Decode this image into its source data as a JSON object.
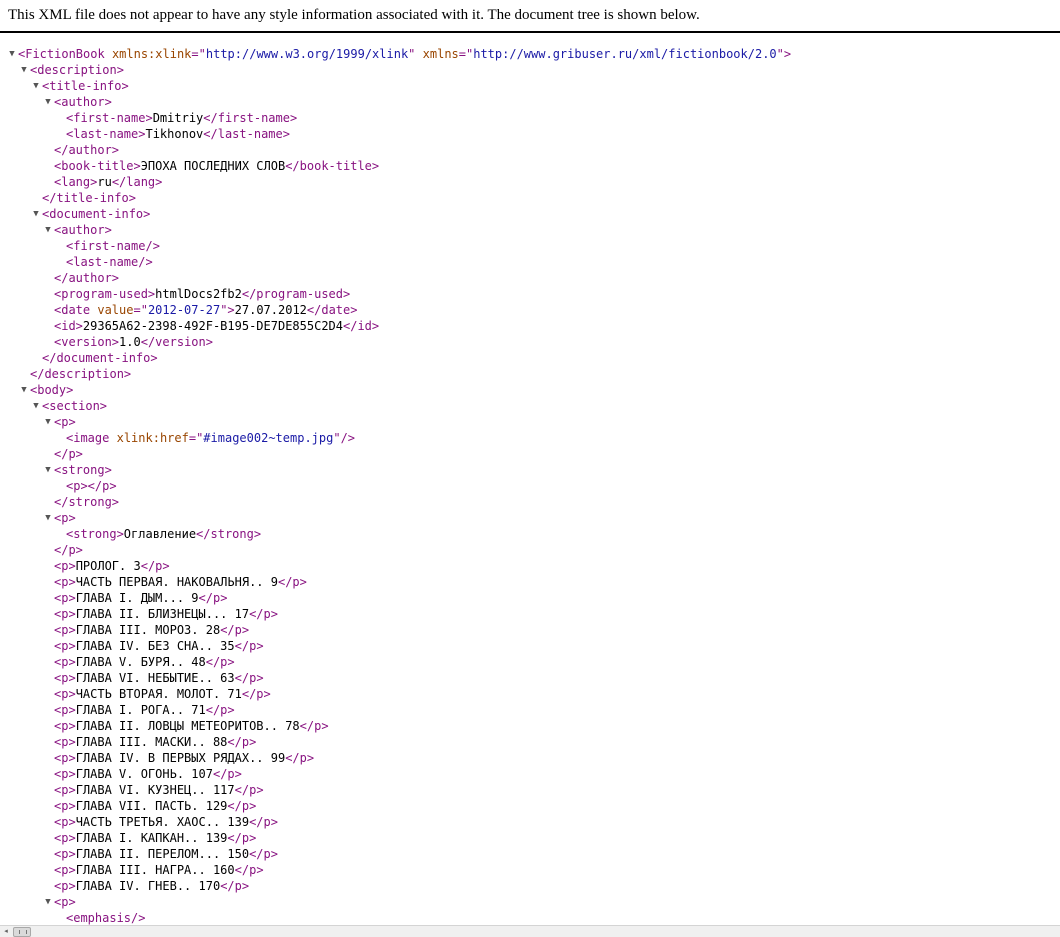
{
  "notice": "This XML file does not appear to have any style information associated with it. The document tree is shown below.",
  "toggle_glyph": "▼",
  "colors": {
    "tag": "#881280",
    "attr_name": "#994500",
    "attr_value": "#1a1aa6",
    "text": "#000000"
  },
  "tree": [
    {
      "depth": 0,
      "toggle": true,
      "tokens": [
        [
          "t",
          "<FictionBook"
        ],
        [
          "x",
          " "
        ],
        [
          "an",
          "xmlns:xlink"
        ],
        [
          "t",
          "=\""
        ],
        [
          "av",
          "http://www.w3.org/1999/xlink"
        ],
        [
          "t",
          "\""
        ],
        [
          "x",
          " "
        ],
        [
          "an",
          "xmlns"
        ],
        [
          "t",
          "=\""
        ],
        [
          "av",
          "http://www.gribuser.ru/xml/fictionbook/2.0"
        ],
        [
          "t",
          "\">"
        ]
      ]
    },
    {
      "depth": 1,
      "toggle": true,
      "tokens": [
        [
          "t",
          "<description>"
        ]
      ]
    },
    {
      "depth": 2,
      "toggle": true,
      "tokens": [
        [
          "t",
          "<title-info>"
        ]
      ]
    },
    {
      "depth": 3,
      "toggle": true,
      "tokens": [
        [
          "t",
          "<author>"
        ]
      ]
    },
    {
      "depth": 4,
      "toggle": false,
      "tokens": [
        [
          "t",
          "<first-name>"
        ],
        [
          "x",
          "Dmitriy"
        ],
        [
          "t",
          "</first-name>"
        ]
      ]
    },
    {
      "depth": 4,
      "toggle": false,
      "tokens": [
        [
          "t",
          "<last-name>"
        ],
        [
          "x",
          "Tikhonov"
        ],
        [
          "t",
          "</last-name>"
        ]
      ]
    },
    {
      "depth": 3,
      "toggle": false,
      "tokens": [
        [
          "t",
          "</author>"
        ]
      ]
    },
    {
      "depth": 3,
      "toggle": false,
      "tokens": [
        [
          "t",
          "<book-title>"
        ],
        [
          "x",
          "ЭПОХА ПОСЛЕДНИХ СЛОВ"
        ],
        [
          "t",
          "</book-title>"
        ]
      ]
    },
    {
      "depth": 3,
      "toggle": false,
      "tokens": [
        [
          "t",
          "<lang>"
        ],
        [
          "x",
          "ru"
        ],
        [
          "t",
          "</lang>"
        ]
      ]
    },
    {
      "depth": 2,
      "toggle": false,
      "tokens": [
        [
          "t",
          "</title-info>"
        ]
      ]
    },
    {
      "depth": 2,
      "toggle": true,
      "tokens": [
        [
          "t",
          "<document-info>"
        ]
      ]
    },
    {
      "depth": 3,
      "toggle": true,
      "tokens": [
        [
          "t",
          "<author>"
        ]
      ]
    },
    {
      "depth": 4,
      "toggle": false,
      "tokens": [
        [
          "t",
          "<first-name/>"
        ]
      ]
    },
    {
      "depth": 4,
      "toggle": false,
      "tokens": [
        [
          "t",
          "<last-name/>"
        ]
      ]
    },
    {
      "depth": 3,
      "toggle": false,
      "tokens": [
        [
          "t",
          "</author>"
        ]
      ]
    },
    {
      "depth": 3,
      "toggle": false,
      "tokens": [
        [
          "t",
          "<program-used>"
        ],
        [
          "x",
          "htmlDocs2fb2"
        ],
        [
          "t",
          "</program-used>"
        ]
      ]
    },
    {
      "depth": 3,
      "toggle": false,
      "tokens": [
        [
          "t",
          "<date"
        ],
        [
          "x",
          " "
        ],
        [
          "an",
          "value"
        ],
        [
          "t",
          "=\""
        ],
        [
          "av",
          "2012-07-27"
        ],
        [
          "t",
          "\">"
        ],
        [
          "x",
          "27.07.2012"
        ],
        [
          "t",
          "</date>"
        ]
      ]
    },
    {
      "depth": 3,
      "toggle": false,
      "tokens": [
        [
          "t",
          "<id>"
        ],
        [
          "x",
          "29365A62-2398-492F-B195-DE7DE855C2D4"
        ],
        [
          "t",
          "</id>"
        ]
      ]
    },
    {
      "depth": 3,
      "toggle": false,
      "tokens": [
        [
          "t",
          "<version>"
        ],
        [
          "x",
          "1.0"
        ],
        [
          "t",
          "</version>"
        ]
      ]
    },
    {
      "depth": 2,
      "toggle": false,
      "tokens": [
        [
          "t",
          "</document-info>"
        ]
      ]
    },
    {
      "depth": 1,
      "toggle": false,
      "tokens": [
        [
          "t",
          "</description>"
        ]
      ]
    },
    {
      "depth": 1,
      "toggle": true,
      "tokens": [
        [
          "t",
          "<body>"
        ]
      ]
    },
    {
      "depth": 2,
      "toggle": true,
      "tokens": [
        [
          "t",
          "<section>"
        ]
      ]
    },
    {
      "depth": 3,
      "toggle": true,
      "tokens": [
        [
          "t",
          "<p>"
        ]
      ]
    },
    {
      "depth": 4,
      "toggle": false,
      "tokens": [
        [
          "t",
          "<image"
        ],
        [
          "x",
          " "
        ],
        [
          "an",
          "xlink:href"
        ],
        [
          "t",
          "=\""
        ],
        [
          "av",
          "#image002~temp.jpg"
        ],
        [
          "t",
          "\"/>"
        ]
      ]
    },
    {
      "depth": 3,
      "toggle": false,
      "tokens": [
        [
          "t",
          "</p>"
        ]
      ]
    },
    {
      "depth": 3,
      "toggle": true,
      "tokens": [
        [
          "t",
          "<strong>"
        ]
      ]
    },
    {
      "depth": 4,
      "toggle": false,
      "tokens": [
        [
          "t",
          "<p></p>"
        ]
      ]
    },
    {
      "depth": 3,
      "toggle": false,
      "tokens": [
        [
          "t",
          "</strong>"
        ]
      ]
    },
    {
      "depth": 3,
      "toggle": true,
      "tokens": [
        [
          "t",
          "<p>"
        ]
      ]
    },
    {
      "depth": 4,
      "toggle": false,
      "tokens": [
        [
          "t",
          "<strong>"
        ],
        [
          "x",
          "Оглавление"
        ],
        [
          "t",
          "</strong>"
        ]
      ]
    },
    {
      "depth": 3,
      "toggle": false,
      "tokens": [
        [
          "t",
          "</p>"
        ]
      ]
    },
    {
      "depth": 3,
      "toggle": false,
      "tokens": [
        [
          "t",
          "<p>"
        ],
        [
          "x",
          "ПРОЛОГ. 3"
        ],
        [
          "t",
          "</p>"
        ]
      ]
    },
    {
      "depth": 3,
      "toggle": false,
      "tokens": [
        [
          "t",
          "<p>"
        ],
        [
          "x",
          "ЧАСТЬ ПЕРВАЯ. НАКОВАЛЬНЯ.. 9"
        ],
        [
          "t",
          "</p>"
        ]
      ]
    },
    {
      "depth": 3,
      "toggle": false,
      "tokens": [
        [
          "t",
          "<p>"
        ],
        [
          "x",
          "ГЛАВА I. ДЫМ... 9"
        ],
        [
          "t",
          "</p>"
        ]
      ]
    },
    {
      "depth": 3,
      "toggle": false,
      "tokens": [
        [
          "t",
          "<p>"
        ],
        [
          "x",
          "ГЛАВА II. БЛИЗНЕЦЫ... 17"
        ],
        [
          "t",
          "</p>"
        ]
      ]
    },
    {
      "depth": 3,
      "toggle": false,
      "tokens": [
        [
          "t",
          "<p>"
        ],
        [
          "x",
          "ГЛАВА III. МОРОЗ. 28"
        ],
        [
          "t",
          "</p>"
        ]
      ]
    },
    {
      "depth": 3,
      "toggle": false,
      "tokens": [
        [
          "t",
          "<p>"
        ],
        [
          "x",
          "ГЛАВА IV. БЕЗ СНА.. 35"
        ],
        [
          "t",
          "</p>"
        ]
      ]
    },
    {
      "depth": 3,
      "toggle": false,
      "tokens": [
        [
          "t",
          "<p>"
        ],
        [
          "x",
          "ГЛАВА V. БУРЯ.. 48"
        ],
        [
          "t",
          "</p>"
        ]
      ]
    },
    {
      "depth": 3,
      "toggle": false,
      "tokens": [
        [
          "t",
          "<p>"
        ],
        [
          "x",
          "ГЛАВА VI. НЕБЫТИЕ.. 63"
        ],
        [
          "t",
          "</p>"
        ]
      ]
    },
    {
      "depth": 3,
      "toggle": false,
      "tokens": [
        [
          "t",
          "<p>"
        ],
        [
          "x",
          "ЧАСТЬ ВТОРАЯ. МОЛОТ. 71"
        ],
        [
          "t",
          "</p>"
        ]
      ]
    },
    {
      "depth": 3,
      "toggle": false,
      "tokens": [
        [
          "t",
          "<p>"
        ],
        [
          "x",
          "ГЛАВА I. РОГА.. 71"
        ],
        [
          "t",
          "</p>"
        ]
      ]
    },
    {
      "depth": 3,
      "toggle": false,
      "tokens": [
        [
          "t",
          "<p>"
        ],
        [
          "x",
          "ГЛАВА II. ЛОВЦЫ МЕТЕОРИТОВ.. 78"
        ],
        [
          "t",
          "</p>"
        ]
      ]
    },
    {
      "depth": 3,
      "toggle": false,
      "tokens": [
        [
          "t",
          "<p>"
        ],
        [
          "x",
          "ГЛАВА III. МАСКИ.. 88"
        ],
        [
          "t",
          "</p>"
        ]
      ]
    },
    {
      "depth": 3,
      "toggle": false,
      "tokens": [
        [
          "t",
          "<p>"
        ],
        [
          "x",
          "ГЛАВА IV. В ПЕРВЫХ РЯДАХ.. 99"
        ],
        [
          "t",
          "</p>"
        ]
      ]
    },
    {
      "depth": 3,
      "toggle": false,
      "tokens": [
        [
          "t",
          "<p>"
        ],
        [
          "x",
          "ГЛАВА V. ОГОНЬ. 107"
        ],
        [
          "t",
          "</p>"
        ]
      ]
    },
    {
      "depth": 3,
      "toggle": false,
      "tokens": [
        [
          "t",
          "<p>"
        ],
        [
          "x",
          "ГЛАВА VI. КУЗНЕЦ.. 117"
        ],
        [
          "t",
          "</p>"
        ]
      ]
    },
    {
      "depth": 3,
      "toggle": false,
      "tokens": [
        [
          "t",
          "<p>"
        ],
        [
          "x",
          "ГЛАВА VII. ПАСТЬ. 129"
        ],
        [
          "t",
          "</p>"
        ]
      ]
    },
    {
      "depth": 3,
      "toggle": false,
      "tokens": [
        [
          "t",
          "<p>"
        ],
        [
          "x",
          "ЧАСТЬ ТРЕТЬЯ. ХАОС.. 139"
        ],
        [
          "t",
          "</p>"
        ]
      ]
    },
    {
      "depth": 3,
      "toggle": false,
      "tokens": [
        [
          "t",
          "<p>"
        ],
        [
          "x",
          "ГЛАВА I. КАПКАН.. 139"
        ],
        [
          "t",
          "</p>"
        ]
      ]
    },
    {
      "depth": 3,
      "toggle": false,
      "tokens": [
        [
          "t",
          "<p>"
        ],
        [
          "x",
          "ГЛАВА II. ПЕРЕЛОМ... 150"
        ],
        [
          "t",
          "</p>"
        ]
      ]
    },
    {
      "depth": 3,
      "toggle": false,
      "tokens": [
        [
          "t",
          "<p>"
        ],
        [
          "x",
          "ГЛАВА III. НАГРА.. 160"
        ],
        [
          "t",
          "</p>"
        ]
      ]
    },
    {
      "depth": 3,
      "toggle": false,
      "tokens": [
        [
          "t",
          "<p>"
        ],
        [
          "x",
          "ГЛАВА IV. ГНЕВ.. 170"
        ],
        [
          "t",
          "</p>"
        ]
      ]
    },
    {
      "depth": 3,
      "toggle": true,
      "tokens": [
        [
          "t",
          "<p>"
        ]
      ]
    },
    {
      "depth": 4,
      "toggle": false,
      "tokens": [
        [
          "t",
          "<emphasis/>"
        ]
      ]
    }
  ],
  "scrollbar": {
    "left_arrow": "◂",
    "thumb_icon": "grip-icon"
  }
}
